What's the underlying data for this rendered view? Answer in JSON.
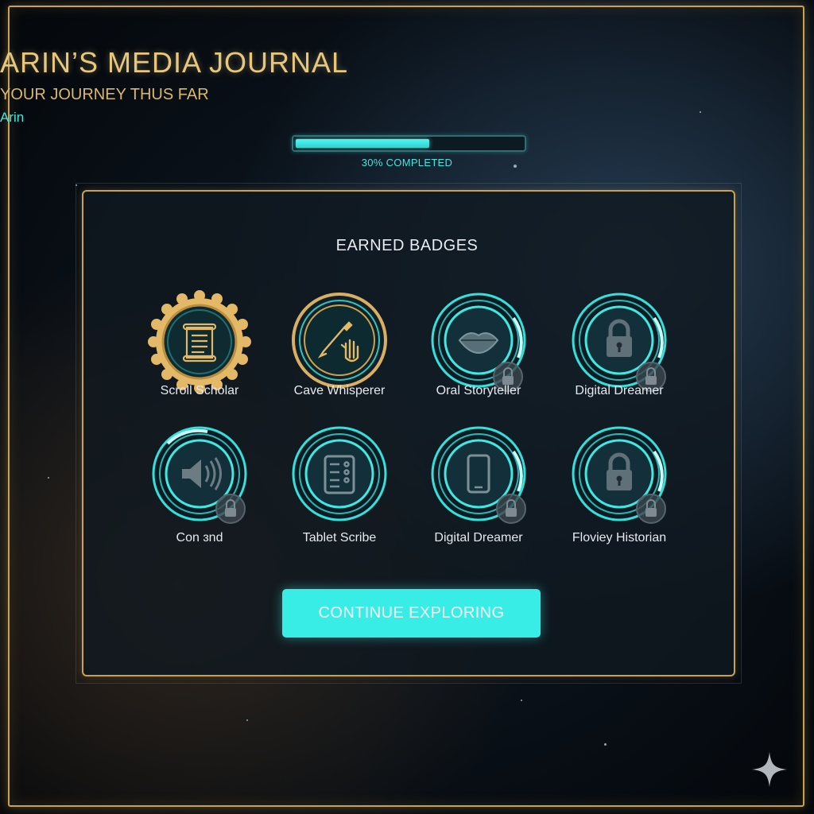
{
  "journal": {
    "title": "ARIN’S MEDIA JOURNAL",
    "subtitle": "YOUR JOURNEY THUS FAR",
    "user_name": "Arin",
    "progress_fraction": 0.3,
    "progress_label": "30% COMPLETED"
  },
  "badges_section": {
    "title": "EARNED BADGES",
    "badges": [
      {
        "label": "Scroll Scholar",
        "icon": "scroll-icon",
        "style": "gold-gear",
        "locked": false
      },
      {
        "label": "Cave Whisperer",
        "icon": "brush-hand-icon",
        "style": "gold-ring",
        "locked": false
      },
      {
        "label": "Oral Storyteller",
        "icon": "lips-icon",
        "style": "teal-ring",
        "locked": true
      },
      {
        "label": "Digital Dreamer",
        "icon": "padlock-icon",
        "style": "teal-ring",
        "locked": true
      },
      {
        "label": "Con ɜnd",
        "icon": "speaker-icon",
        "style": "teal-ring",
        "locked": true
      },
      {
        "label": "Tablet Scribe",
        "icon": "tablet-icon",
        "style": "teal-ring",
        "locked": false
      },
      {
        "label": "Digital Dreamer",
        "icon": "phone-icon",
        "style": "teal-ring",
        "locked": true
      },
      {
        "label": "Floviey Historian",
        "icon": "padlock-icon",
        "style": "teal-ring",
        "locked": true
      }
    ]
  },
  "cta": {
    "label": "CONTINUE EXPLORING"
  },
  "colors": {
    "gold": "#c9a24e",
    "teal": "#38ede6",
    "background": "#0a121a"
  }
}
